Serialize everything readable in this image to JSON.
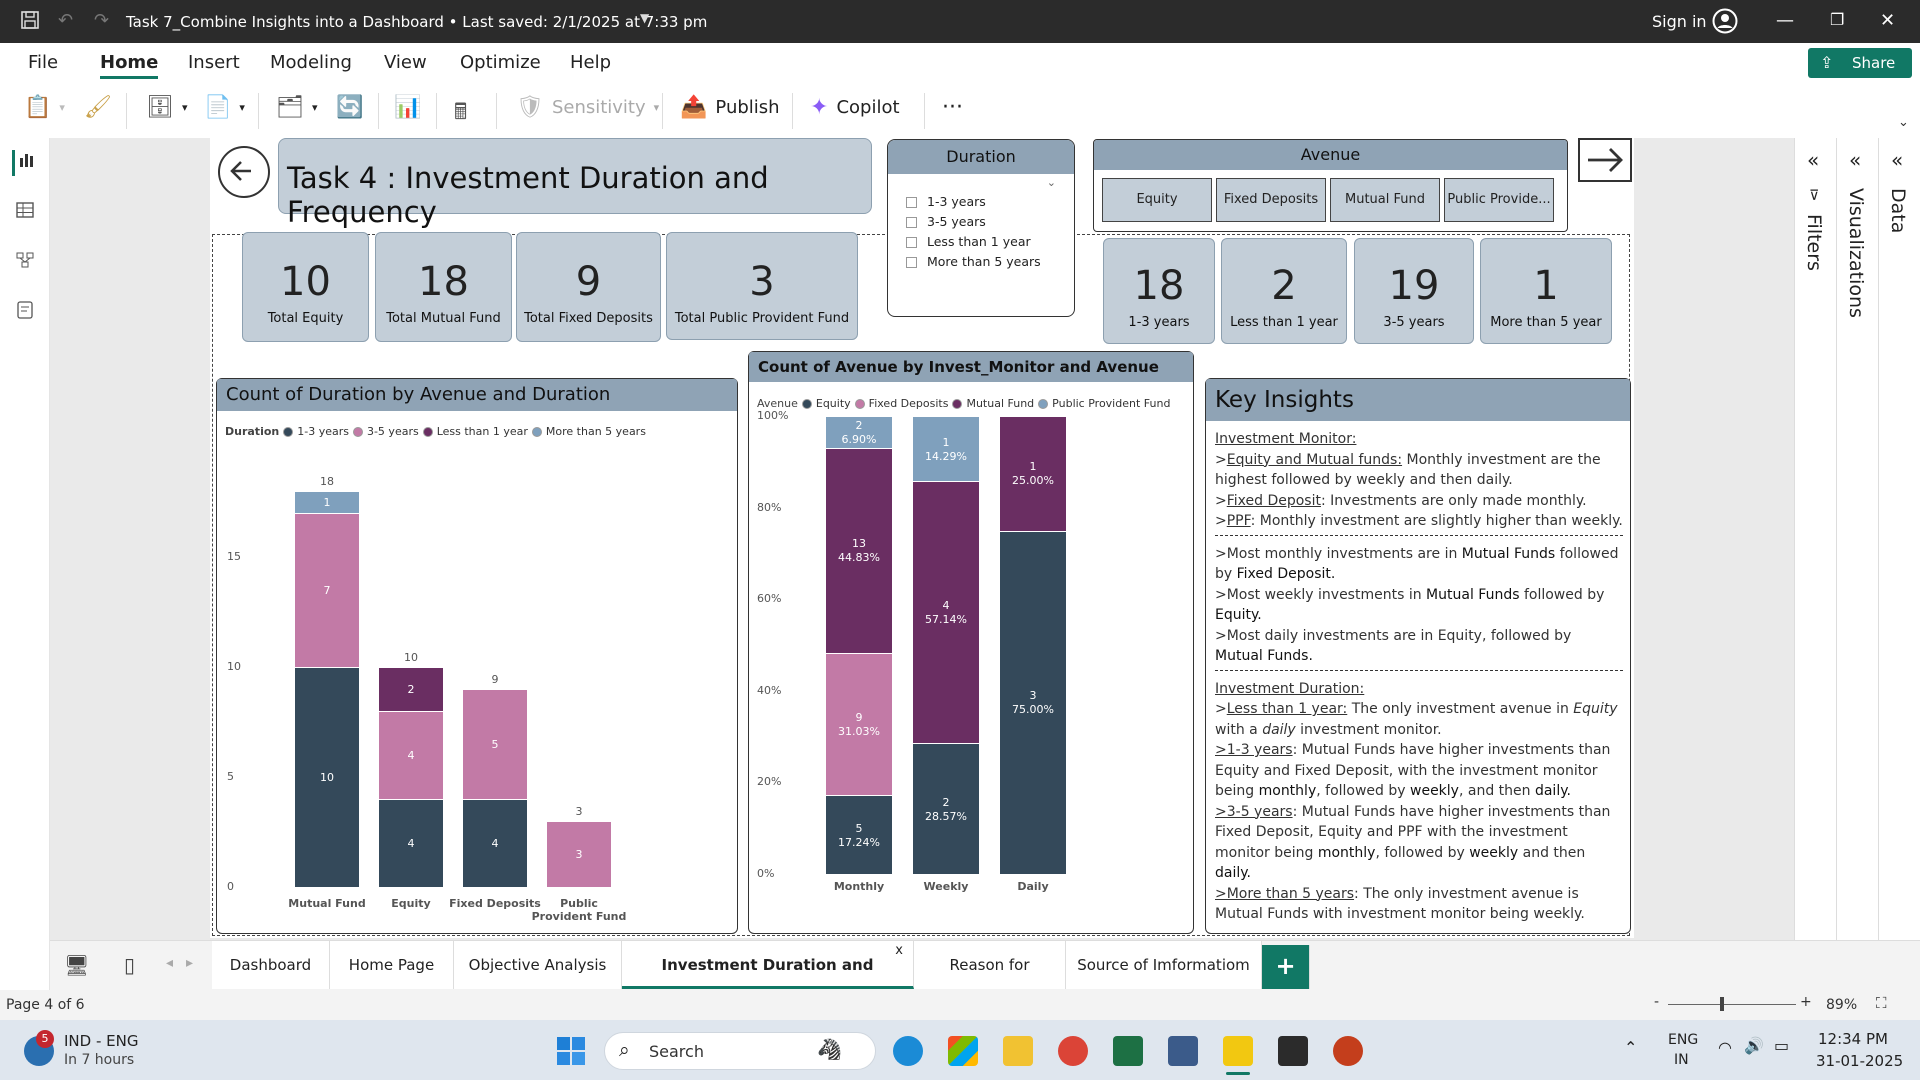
{
  "window": {
    "title": "Task 7_Combine Insights into a Dashboard  •  Last saved: 2/1/2025 at 7:33 pm",
    "signin": "Sign in"
  },
  "menu": [
    "File",
    "Home",
    "Insert",
    "Modeling",
    "View",
    "Optimize",
    "Help"
  ],
  "share": "Share",
  "ribbon": {
    "sensitivity": "Sensitivity",
    "publish": "Publish",
    "copilot": "Copilot",
    "more": "···"
  },
  "right_pane": {
    "filters": "Filters",
    "visualizations": "Visualizations",
    "data": "Data"
  },
  "report": {
    "title": "Task 4 : Investment Duration and Frequency",
    "cards_left": [
      {
        "value": "10",
        "label": "Total Equity"
      },
      {
        "value": "18",
        "label": "Total Mutual Fund"
      },
      {
        "value": "9",
        "label": "Total Fixed Deposits"
      },
      {
        "value": "3",
        "label": "Total Public Provident Fund"
      }
    ],
    "duration_slicer": {
      "title": "Duration",
      "options": [
        "1-3 years",
        "3-5 years",
        "Less than 1 year",
        "More than 5 years"
      ]
    },
    "avenue_slicer": {
      "title": "Avenue",
      "options": [
        "Equity",
        "Fixed Deposits",
        "Mutual Fund",
        "Public Provide..."
      ]
    },
    "cards_right": [
      {
        "value": "18",
        "label": "1-3 years"
      },
      {
        "value": "2",
        "label": "Less than 1 year"
      },
      {
        "value": "19",
        "label": "3-5 years"
      },
      {
        "value": "1",
        "label": "More than 5 year"
      }
    ],
    "insights": {
      "title": "Key Insights",
      "monitor_head": "Investment Monitor:",
      "m1a": ">",
      "m1b": "Equity and Mutual funds:",
      "m1c": " Monthly investment are the highest followed by weekly and then daily.",
      "m2a": ">",
      "m2b": "Fixed Deposit",
      "m2c": ": Investments are only made monthly.",
      "m3a": ">",
      "m3b": "PPF",
      "m3c": ": Monthly investment are slightly higher than weekly.",
      "s1a": ">Most monthly investments are in ",
      "s1b": "Mutual Funds",
      "s1c": " followed by ",
      "s1d": "Fixed Deposit.",
      "s2a": ">Most weekly investments in ",
      "s2b": "Mutual Funds",
      "s2c": " followed by ",
      "s2d": "Equity.",
      "s3a": ">Most daily investments are in Equity, followed by ",
      "s3b": "Mutual Funds.",
      "duration_head": "Investment Duration:",
      "d1a": ">",
      "d1b": "Less than 1 year:",
      "d1c": " The only investment avenue in ",
      "d1d": "Equity",
      "d1e": " with a ",
      "d1f": "daily",
      "d1g": " investment monitor.",
      "d2a": ">1-3 years",
      "d2b": ": Mutual Funds have higher investments than Equity and Fixed Deposit, with the investment monitor being ",
      "d2c": "monthly",
      "d2d": ", followed by ",
      "d2e": "weekly",
      "d2f": ", and then ",
      "d2g": "daily.",
      "d3a": ">3-5 years",
      "d3b": ": Mutual Funds have higher investments than Fixed Deposit, Equity and PPF with the investment monitor being ",
      "d3c": "monthly",
      "d3d": ", followed by ",
      "d3e": "weekly",
      "d3f": " and then ",
      "d3g": "daily.",
      "d4a": ">More than 5 years",
      "d4b": ": The only investment avenue is Mutual Funds with investment monitor being weekly."
    }
  },
  "chart_data": [
    {
      "type": "bar",
      "stacked": true,
      "title": "Count of Duration by Avenue and Duration",
      "legend_title": "Duration",
      "categories": [
        "Mutual Fund",
        "Equity",
        "Fixed Deposits",
        "Public Provident Fund"
      ],
      "series": [
        {
          "name": "1-3 years",
          "color": "#34495a",
          "values": [
            10,
            4,
            4,
            0
          ]
        },
        {
          "name": "3-5 years",
          "color": "#c27aa6",
          "values": [
            7,
            4,
            5,
            3
          ]
        },
        {
          "name": "Less than 1 year",
          "color": "#6a2e62",
          "values": [
            0,
            2,
            0,
            0
          ]
        },
        {
          "name": "More than 5 years",
          "color": "#7fa0bd",
          "values": [
            1,
            0,
            0,
            0
          ]
        }
      ],
      "totals": [
        "18",
        "10",
        "9",
        "3"
      ],
      "yticks": [
        "0",
        "5",
        "10",
        "15"
      ],
      "ylim": [
        0,
        20
      ]
    },
    {
      "type": "bar",
      "stacked": "100%",
      "title": "Count of Avenue by Invest_Monitor and Avenue",
      "legend_title": "Avenue",
      "categories": [
        "Monthly",
        "Weekly",
        "Daily"
      ],
      "series": [
        {
          "name": "Equity",
          "color": "#34495a",
          "values": [
            5,
            2,
            3
          ],
          "labels": [
            "17.24%",
            "28.57%",
            "75.00%"
          ]
        },
        {
          "name": "Fixed Deposits",
          "color": "#c27aa6",
          "values": [
            9,
            0,
            0
          ],
          "labels": [
            "31.03%",
            "",
            ""
          ]
        },
        {
          "name": "Mutual Fund",
          "color": "#6a2e62",
          "values": [
            13,
            4,
            1
          ],
          "labels": [
            "44.83%",
            "57.14%",
            "25.00%"
          ]
        },
        {
          "name": "Public Provident Fund",
          "color": "#7fa0bd",
          "values": [
            2,
            1,
            0
          ],
          "labels": [
            "6.90%",
            "14.29%",
            ""
          ]
        }
      ],
      "yticks": [
        "0%",
        "20%",
        "40%",
        "60%",
        "80%",
        "100%"
      ]
    }
  ],
  "tabs": [
    "Dashboard",
    "Home Page",
    "Objective Analysis",
    "Investment Duration and Frequency",
    "Reason for Investment",
    "Source of Imformatiom"
  ],
  "tab_close": "x",
  "tab_add": "+",
  "status": {
    "page": "Page 4 of 6",
    "zoom": "89%",
    "zoom_minus": "-",
    "zoom_plus": "+"
  },
  "taskbar": {
    "notif": "5",
    "weather1": "IND - ENG",
    "weather2": "In 7 hours",
    "search": "Search",
    "lang1": "ENG",
    "lang2": "IN",
    "time": "12:34 PM",
    "date": "31-01-2025"
  }
}
